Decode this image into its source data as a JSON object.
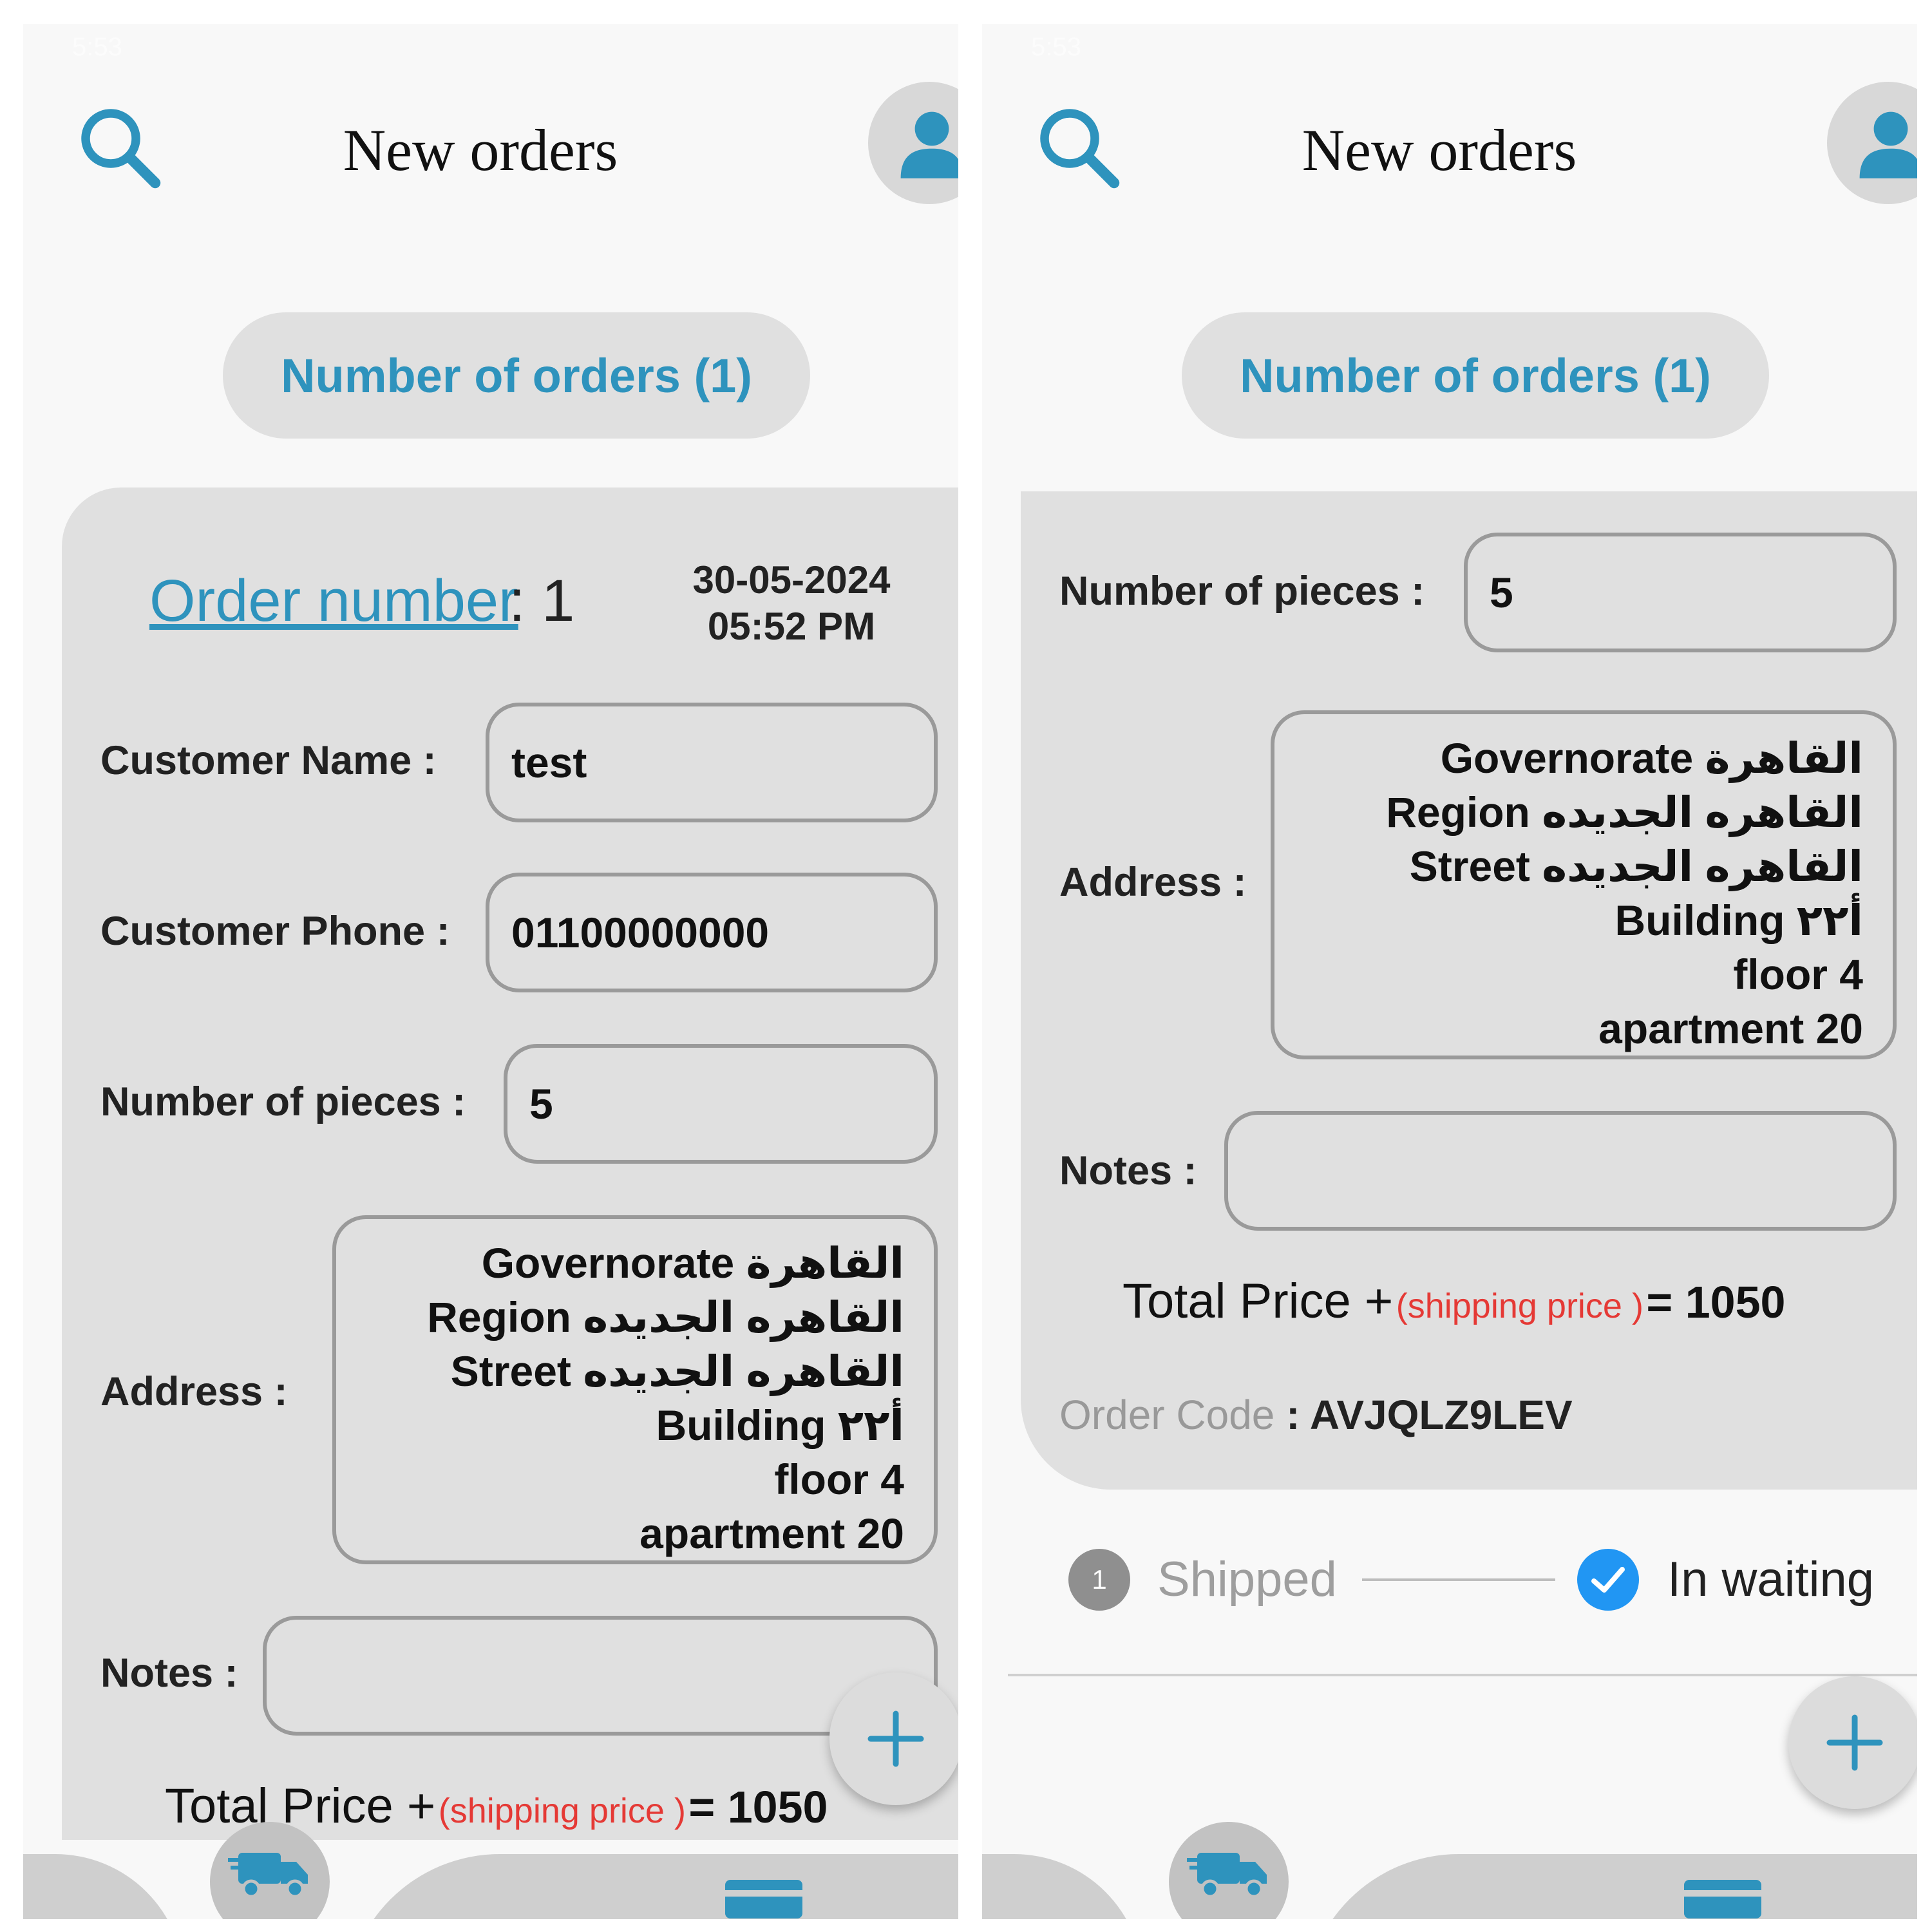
{
  "colors": {
    "accent": "#2e93bd",
    "card_background": "#e0e0e0",
    "shipping_note": "#e53935",
    "step_active": "#2196f3",
    "step_inactive": "#8f8f8f"
  },
  "screens": [
    {
      "status_bar": {
        "time": "5:53"
      },
      "header": {
        "title": "New orders"
      },
      "orders_count_label": "Number of orders (1)",
      "order": {
        "number_label": "Order number",
        "number_separator": ": 1",
        "date": "30-05-2024",
        "time": "05:52 PM",
        "customer_name_label": "Customer Name  :",
        "customer_name_value": "test",
        "customer_phone_label": "Customer Phone :",
        "customer_phone_value": "01100000000",
        "pieces_label": "Number of pieces :",
        "pieces_value": "5",
        "address_label": "Address :",
        "address_lines": [
          "Governorate القاهرة",
          "Region القاهره الجديده",
          "Street القاهره الجديده",
          "Building أ٢٢",
          "floor 4",
          "apartment 20"
        ],
        "notes_label": "Notes :",
        "notes_value": "",
        "total_label": "Total Price +",
        "shipping_label": "(shipping price )",
        "total_value": "= 1050"
      },
      "fab_icon": "plus-icon",
      "bottom_nav": {
        "center_icon": "truck-icon",
        "right_icon": "wallet-icon"
      }
    },
    {
      "status_bar": {
        "time": "5:53"
      },
      "header": {
        "title": "New orders"
      },
      "orders_count_label": "Number of orders (1)",
      "order": {
        "pieces_label": "Number of pieces :",
        "pieces_value": "5",
        "address_label": "Address :",
        "address_lines": [
          "Governorate القاهرة",
          "Region القاهره الجديده",
          "Street القاهره الجديده",
          "Building أ٢٢",
          "floor 4",
          "apartment 20"
        ],
        "notes_label": "Notes :",
        "notes_value": "",
        "total_label": "Total Price +",
        "shipping_label": "(shipping price )",
        "total_value": "= 1050",
        "code_label": "Order Code",
        "code_separator": " : ",
        "code_value": "AVJQLZ9LEV"
      },
      "stepper": {
        "step1_number": "1",
        "step1_label": "Shipped",
        "step2_label": "In waiting",
        "step2_state": "checked"
      },
      "fab_icon": "plus-icon",
      "bottom_nav": {
        "center_icon": "truck-icon",
        "right_icon": "wallet-icon"
      }
    }
  ]
}
